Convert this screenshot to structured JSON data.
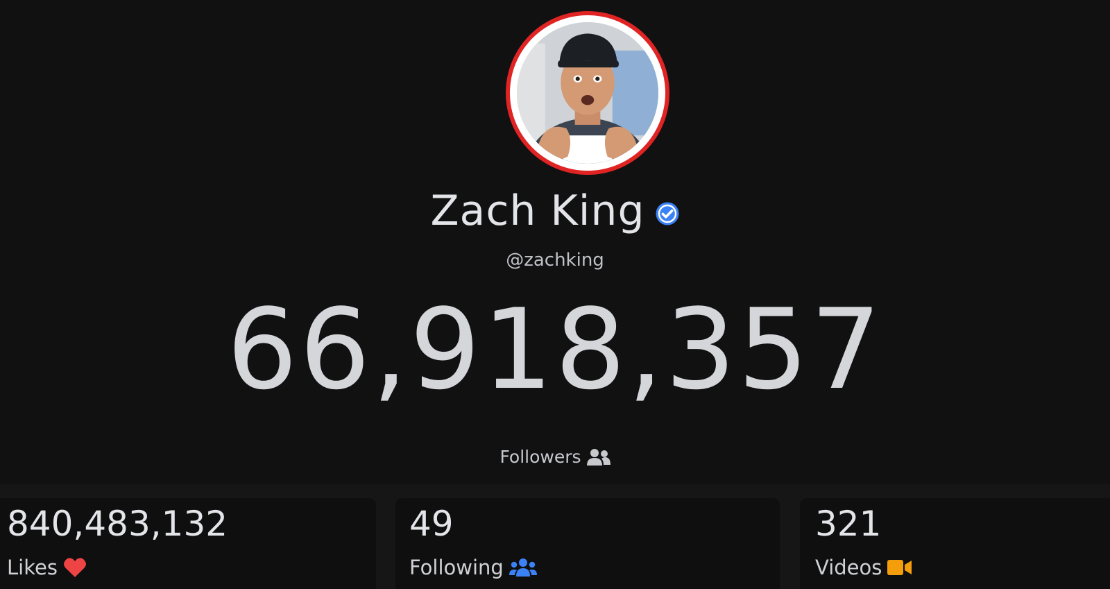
{
  "profile": {
    "display_name": "Zach King",
    "handle": "@zachking",
    "verified": true,
    "followers_count": "66,918,357",
    "followers_label": "Followers"
  },
  "stats": {
    "likes": {
      "value": "840,483,132",
      "label": "Likes",
      "icon": "heart-icon"
    },
    "following": {
      "value": "49",
      "label": "Following",
      "icon": "users-icon"
    },
    "videos": {
      "value": "321",
      "label": "Videos",
      "icon": "video-camera-icon"
    }
  },
  "colors": {
    "background": "#111112",
    "avatar_ring": "#e02424",
    "verified_badge": "#3b82f6",
    "heart": "#ef4444",
    "users": "#3b82f6",
    "video": "#f59e0b"
  }
}
